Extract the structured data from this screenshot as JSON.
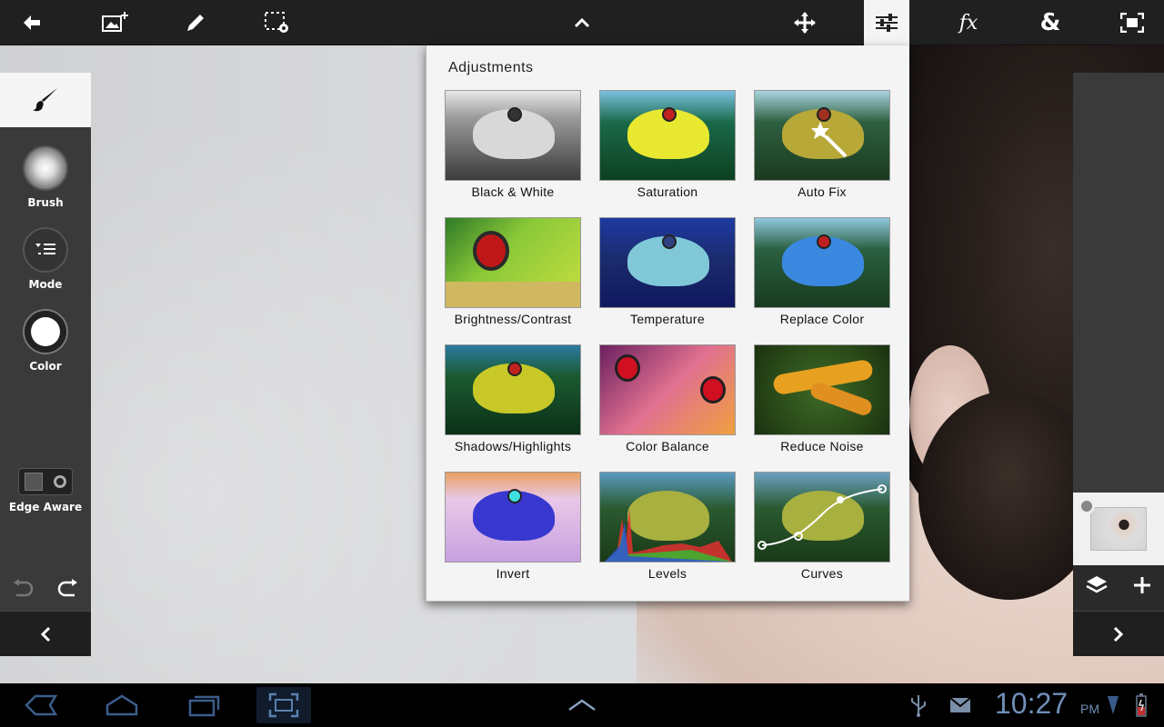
{
  "toolbar": {
    "items": [
      {
        "name": "back-arrow-icon"
      },
      {
        "name": "add-image-icon"
      },
      {
        "name": "pencil-icon"
      },
      {
        "name": "selection-settings-icon"
      },
      {
        "name": "chevron-up-icon"
      },
      {
        "name": "move-icon"
      },
      {
        "name": "adjustments-icon",
        "active": true
      },
      {
        "name": "effects-icon",
        "label": "fx"
      },
      {
        "name": "ampersand-icon",
        "label": "&"
      },
      {
        "name": "fit-screen-icon"
      }
    ]
  },
  "left_panel": {
    "tools": [
      {
        "label": "Brush"
      },
      {
        "label": "Mode"
      },
      {
        "label": "Color"
      }
    ],
    "edge_aware_label": "Edge Aware"
  },
  "adjustments": {
    "title": "Adjustments",
    "items": [
      {
        "label": "Black & White"
      },
      {
        "label": "Saturation"
      },
      {
        "label": "Auto Fix"
      },
      {
        "label": "Brightness/Contrast"
      },
      {
        "label": "Temperature"
      },
      {
        "label": "Replace Color"
      },
      {
        "label": "Shadows/Highlights"
      },
      {
        "label": "Color Balance"
      },
      {
        "label": "Reduce Noise"
      },
      {
        "label": "Invert"
      },
      {
        "label": "Levels"
      },
      {
        "label": "Curves"
      }
    ]
  },
  "status_bar": {
    "time": "10:27",
    "ampm": "PM"
  },
  "colors": {
    "toolbar_bg": "#202020",
    "panel_bg": "#3a3a3a",
    "popover_bg": "#f4f4f4",
    "clock": "#6f8fb8"
  }
}
